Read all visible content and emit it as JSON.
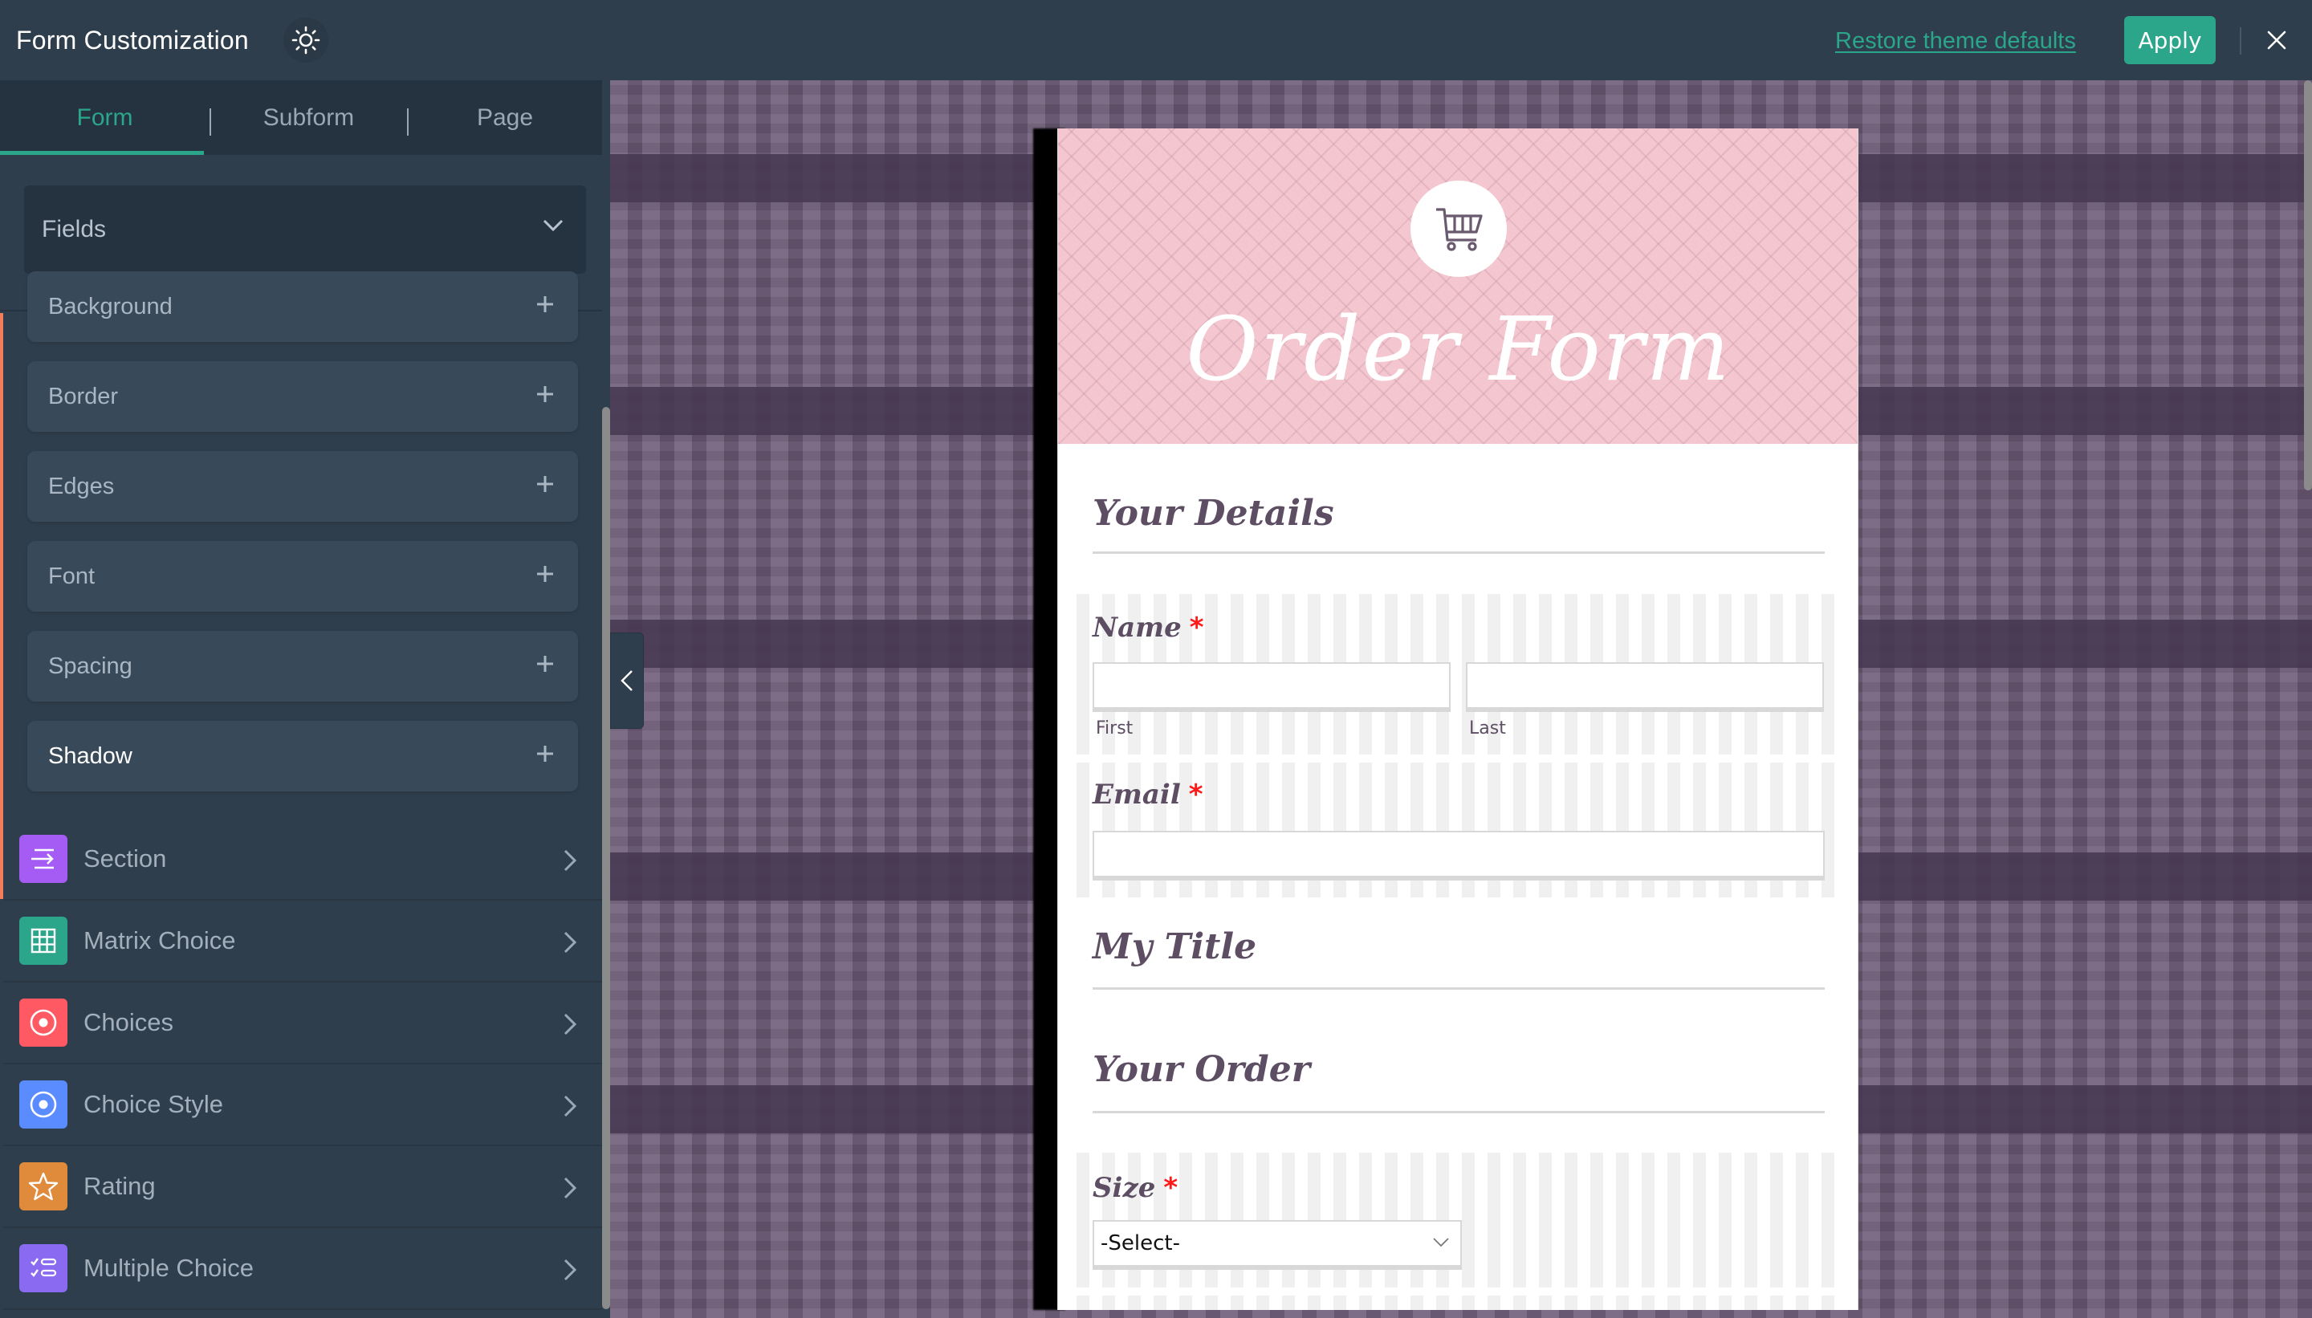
{
  "header": {
    "title": "Form Customization",
    "theme_icon": "sun-icon",
    "restore_label": "Restore theme defaults",
    "apply_label": "Apply",
    "close_icon": "close-icon"
  },
  "sidebar": {
    "tabs": [
      {
        "label": "Form",
        "active": true
      },
      {
        "label": "Subform",
        "active": false
      },
      {
        "label": "Page",
        "active": false
      }
    ],
    "section_select": {
      "value": "Fields",
      "icon": "chevron-down-icon"
    },
    "properties": [
      {
        "label": "Background",
        "icon": "plus-icon"
      },
      {
        "label": "Border",
        "icon": "plus-icon"
      },
      {
        "label": "Edges",
        "icon": "plus-icon"
      },
      {
        "label": "Font",
        "icon": "plus-icon"
      },
      {
        "label": "Spacing",
        "icon": "plus-icon"
      },
      {
        "label": "Shadow",
        "icon": "plus-icon",
        "active": true
      }
    ],
    "groups": [
      {
        "label": "Section",
        "icon": "section-icon",
        "color": "#a55cf5"
      },
      {
        "label": "Matrix Choice",
        "icon": "grid-icon",
        "color": "#2ba68a"
      },
      {
        "label": "Choices",
        "icon": "radio-icon",
        "color": "#ff5a63"
      },
      {
        "label": "Choice Style",
        "icon": "radio-icon",
        "color": "#5a8cff"
      },
      {
        "label": "Rating",
        "icon": "star-icon",
        "color": "#e08a3c"
      },
      {
        "label": "Multiple Choice",
        "icon": "checklist-icon",
        "color": "#8a6af0"
      }
    ]
  },
  "colors": {
    "accent": "#2ba68a",
    "active_bar": "#f37c5a",
    "header_bg": "#2f3e4c",
    "form_header_bg": "#f4c6d0",
    "form_text": "#5d4e63",
    "required": "#ff1a1a"
  },
  "form": {
    "title": "Order Form",
    "logo_icon": "shopping-cart-icon",
    "sections": {
      "details": "Your Details",
      "my_title": "My Title",
      "order": "Your Order"
    },
    "fields": {
      "name": {
        "label": "Name",
        "required_mark": "*",
        "first_value": "",
        "last_value": "",
        "first_sublabel": "First",
        "last_sublabel": "Last"
      },
      "email": {
        "label": "Email",
        "required_mark": "*",
        "value": ""
      },
      "size": {
        "label": "Size",
        "required_mark": "*",
        "selected": "-Select-"
      }
    }
  }
}
